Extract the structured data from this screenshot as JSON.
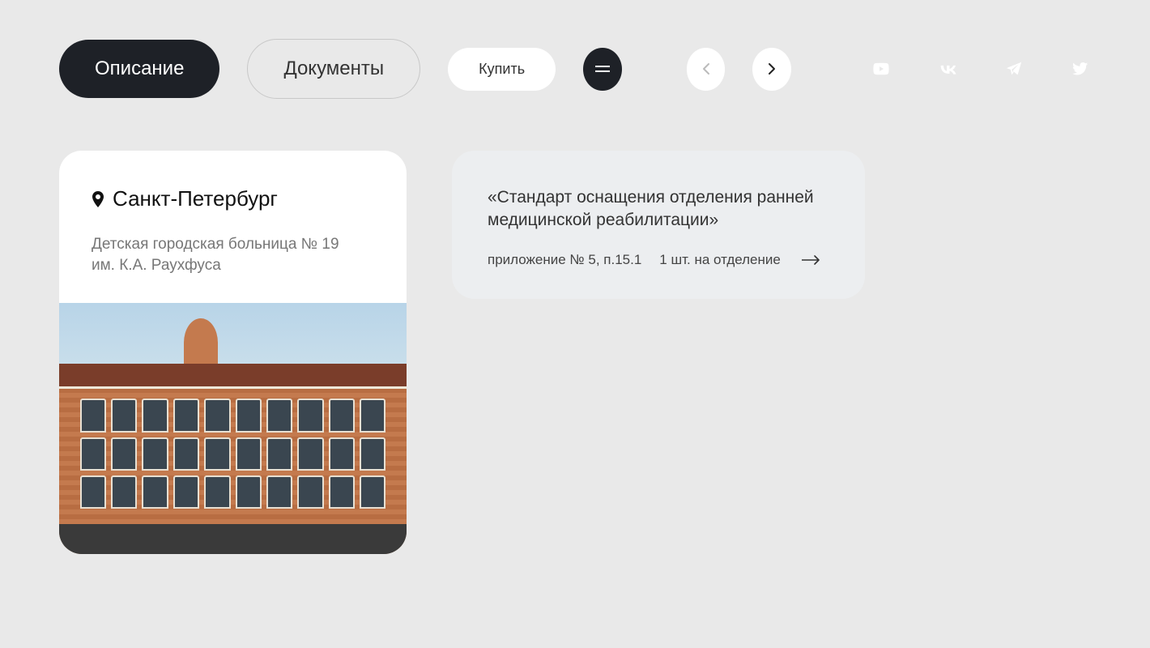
{
  "tabs": {
    "description": "Описание",
    "documents": "Документы"
  },
  "actions": {
    "buy": "Купить"
  },
  "card": {
    "city": "Санкт-Петербург",
    "hospital": "Детская городская больница № 19 им. К.А. Раухфуса"
  },
  "info": {
    "title": "«Стандарт оснащения отделения ранней медицинской реабилитации»",
    "appendix": "приложение № 5, п.15.1",
    "quantity": "1 шт. на отделение"
  },
  "icons": {
    "pin": "pin-icon",
    "menu": "menu-icon",
    "prev": "chevron-left-icon",
    "next": "chevron-right-icon",
    "youtube": "youtube-icon",
    "vk": "vk-icon",
    "telegram": "telegram-icon",
    "twitter": "twitter-icon",
    "arrow": "arrow-right-icon"
  }
}
